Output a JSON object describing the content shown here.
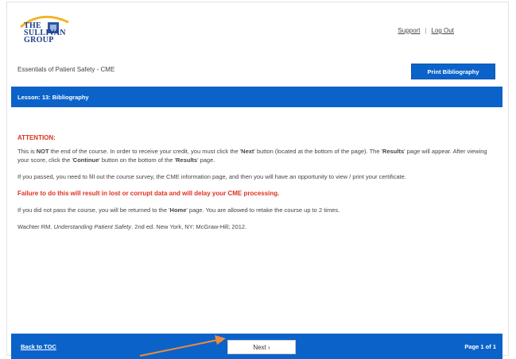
{
  "header": {
    "logo_lines": [
      "THE",
      "SULLIVAN",
      "GROUP"
    ],
    "support_link": "Support",
    "separator": "|",
    "logout_link": "Log Out"
  },
  "course": {
    "title": "Essentials of Patient Safety - CME",
    "print_button": "Print Bibliography"
  },
  "lesson_bar": {
    "title": "Lesson: 13: Bibliography"
  },
  "content": {
    "attention": "ATTENTION:",
    "para1_a": "This is ",
    "para1_not": "NOT",
    "para1_b": " the end of the course. In order to receive your credit, you must click the '",
    "para1_next": "Next",
    "para1_c": "' button (located at the bottom of the page). The '",
    "para1_results": "Results",
    "para1_d": "' page will appear. After viewing your score, click the '",
    "para1_continue": "Continue",
    "para1_e": "' button on the bottom of the '",
    "para1_results2": "Results",
    "para1_f": "' page.",
    "para2": "If you passed, you need to fill out the course survey, the CME information page, and then you will have an opportunity to view / print your certificate.",
    "warning": "Failure to do this will result in lost or corrupt data and will delay your CME processing.",
    "para3_a": "If you did not pass the course, you will be returned to the '",
    "para3_home": "Home",
    "para3_b": "' page. You are allowed to retake the course up to 2 times.",
    "citation_a": "Wachter RM. ",
    "citation_italic": "Understanding Patient Safety",
    "citation_b": ". 2nd ed. New York, NY: McGraw-Hill; 2012."
  },
  "footer": {
    "back_link": "Back to TOC",
    "next_button": "Next  ›",
    "page_indicator": "Page 1 of 1"
  },
  "colors": {
    "primary_blue": "#0b63c9",
    "alert_red": "#e1301e",
    "annotation_arrow": "#f08a3c"
  }
}
